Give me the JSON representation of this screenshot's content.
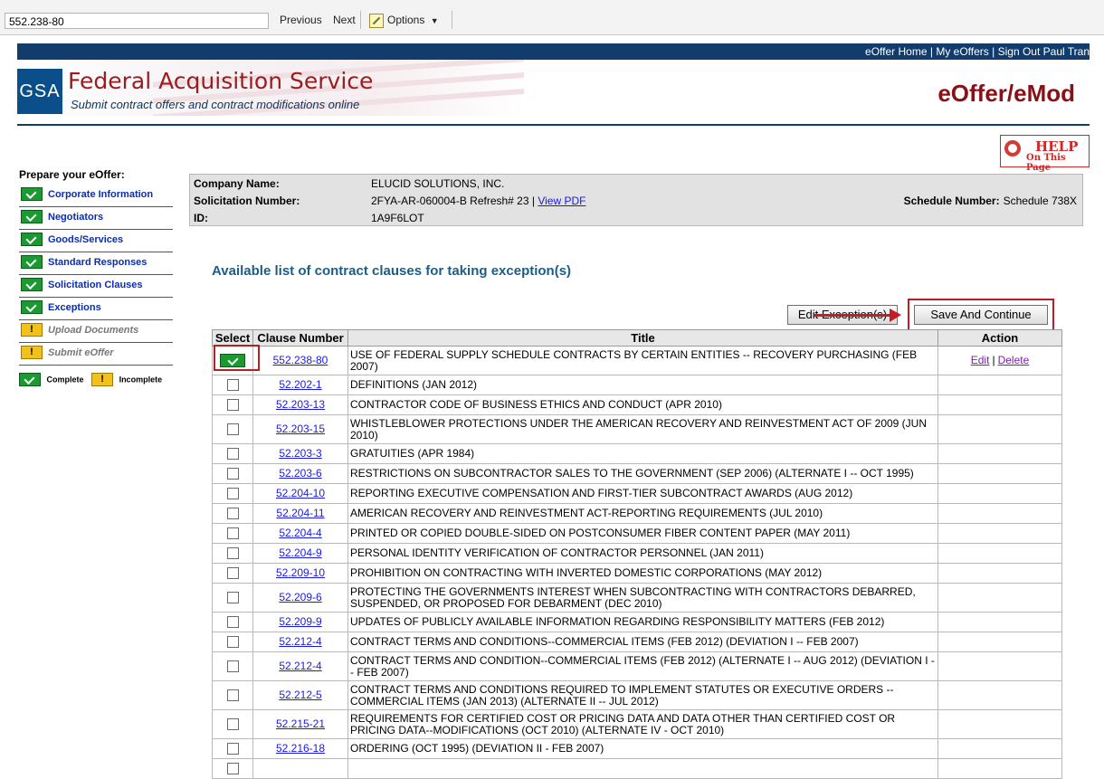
{
  "findbar": {
    "query": "552.238-80",
    "previous_label": "Previous",
    "next_label": "Next",
    "options_label": "Options",
    "options_caret": "▼",
    "options_icon": "pencil-icon"
  },
  "topnav": {
    "links": [
      "eOffer Home",
      "My eOffers",
      "Sign Out Paul Tran"
    ],
    "separator": "|"
  },
  "header": {
    "logo_text": "GSA",
    "title": "Federal Acquisition Service",
    "subtitle": "Submit contract offers and contract modifications online",
    "brand": "eOffer/eMod",
    "help_line1": "HELP",
    "help_line2": "On This Page"
  },
  "leftnav": {
    "heading": "Prepare your eOffer:",
    "items": [
      {
        "label": "Corporate Information",
        "status": "complete"
      },
      {
        "label": "Negotiators",
        "status": "complete"
      },
      {
        "label": "Goods/Services",
        "status": "complete"
      },
      {
        "label": "Standard Responses",
        "status": "complete"
      },
      {
        "label": "Solicitation Clauses",
        "status": "complete"
      },
      {
        "label": "Exceptions",
        "status": "complete"
      },
      {
        "label": "Upload Documents",
        "status": "incomplete"
      },
      {
        "label": "Submit eOffer",
        "status": "incomplete"
      }
    ],
    "legend_complete": "Complete",
    "legend_incomplete": "Incomplete",
    "warn_glyph": "!"
  },
  "company": {
    "name_label": "Company Name:",
    "name": "ELUCID SOLUTIONS, INC.",
    "solicitation_label": "Solicitation Number:",
    "solicitation": "2FYA-AR-060004-B Refresh# 23 |",
    "view_pdf": "View PDF",
    "id_label": "ID:",
    "id": "1A9F6LOT",
    "schedule_label": "Schedule Number:",
    "schedule": "Schedule 738X"
  },
  "section_title": "Available list of contract clauses for taking exception(s)",
  "buttons": {
    "edit_exceptions": "Edit Exception(s)",
    "save_continue": "Save And Continue"
  },
  "table": {
    "headers": [
      "Select",
      "Clause Number",
      "Title",
      "Action"
    ],
    "action_edit": "Edit",
    "action_sep": "|",
    "action_delete": "Delete",
    "rows": [
      {
        "checked": true,
        "number": "552.238-80",
        "title": "USE OF FEDERAL SUPPLY SCHEDULE CONTRACTS BY CERTAIN ENTITIES -- RECOVERY PURCHASING (FEB 2007)",
        "has_actions": true
      },
      {
        "checked": false,
        "number": "52.202-1",
        "title": "DEFINITIONS (JAN 2012)",
        "has_actions": false
      },
      {
        "checked": false,
        "number": "52.203-13",
        "title": "CONTRACTOR CODE OF BUSINESS ETHICS AND CONDUCT (APR 2010)",
        "has_actions": false
      },
      {
        "checked": false,
        "number": "52.203-15",
        "title": "WHISTLEBLOWER PROTECTIONS UNDER THE AMERICAN RECOVERY AND REINVESTMENT ACT OF 2009 (JUN 2010)",
        "has_actions": false
      },
      {
        "checked": false,
        "number": "52.203-3",
        "title": "GRATUITIES (APR 1984)",
        "has_actions": false
      },
      {
        "checked": false,
        "number": "52.203-6",
        "title": "RESTRICTIONS ON SUBCONTRACTOR SALES TO THE GOVERNMENT (SEP 2006) (ALTERNATE I -- OCT 1995)",
        "has_actions": false
      },
      {
        "checked": false,
        "number": "52.204-10",
        "title": "REPORTING EXECUTIVE COMPENSATION AND FIRST-TIER SUBCONTRACT AWARDS (AUG 2012)",
        "has_actions": false
      },
      {
        "checked": false,
        "number": "52.204-11",
        "title": "AMERICAN RECOVERY AND REINVESTMENT ACT-REPORTING REQUIREMENTS (JUL 2010)",
        "has_actions": false
      },
      {
        "checked": false,
        "number": "52.204-4",
        "title": "PRINTED OR COPIED DOUBLE-SIDED ON POSTCONSUMER FIBER CONTENT PAPER (MAY 2011)",
        "has_actions": false
      },
      {
        "checked": false,
        "number": "52.204-9",
        "title": "PERSONAL IDENTITY VERIFICATION OF CONTRACTOR PERSONNEL (JAN 2011)",
        "has_actions": false
      },
      {
        "checked": false,
        "number": "52.209-10",
        "title": "PROHIBITION ON CONTRACTING WITH INVERTED DOMESTIC CORPORATIONS (MAY 2012)",
        "has_actions": false
      },
      {
        "checked": false,
        "number": "52.209-6",
        "title": "PROTECTING THE GOVERNMENTS INTEREST WHEN SUBCONTRACTING WITH CONTRACTORS DEBARRED, SUSPENDED, OR PROPOSED FOR DEBARMENT (DEC 2010)",
        "has_actions": false
      },
      {
        "checked": false,
        "number": "52.209-9",
        "title": "UPDATES OF PUBLICLY AVAILABLE INFORMATION REGARDING RESPONSIBILITY MATTERS (FEB 2012)",
        "has_actions": false
      },
      {
        "checked": false,
        "number": "52.212-4",
        "title": "CONTRACT TERMS AND CONDITIONS--COMMERCIAL ITEMS (FEB 2012) (DEVIATION I -- FEB 2007)",
        "has_actions": false
      },
      {
        "checked": false,
        "number": "52.212-4",
        "title": "CONTRACT TERMS AND CONDITION--COMMERCIAL ITEMS (FEB 2012) (ALTERNATE I -- AUG 2012) (DEVIATION I -- FEB 2007)",
        "has_actions": false
      },
      {
        "checked": false,
        "number": "52.212-5",
        "title": "CONTRACT TERMS AND CONDITIONS REQUIRED TO IMPLEMENT STATUTES OR EXECUTIVE ORDERS -- COMMERCIAL ITEMS (JAN 2013) (ALTERNATE II -- JUL 2012)",
        "has_actions": false
      },
      {
        "checked": false,
        "number": "52.215-21",
        "title": "REQUIREMENTS FOR CERTIFIED COST OR PRICING DATA AND DATA OTHER THAN CERTIFIED COST OR PRICING DATA--MODIFICATIONS (OCT 2010) (ALTERNATE IV - OCT 2010)",
        "has_actions": false
      },
      {
        "checked": false,
        "number": "52.216-18",
        "title": "ORDERING (OCT 1995) (DEVIATION II - FEB 2007)",
        "has_actions": false
      },
      {
        "checked": false,
        "number": "",
        "title": "",
        "has_actions": false
      }
    ]
  }
}
